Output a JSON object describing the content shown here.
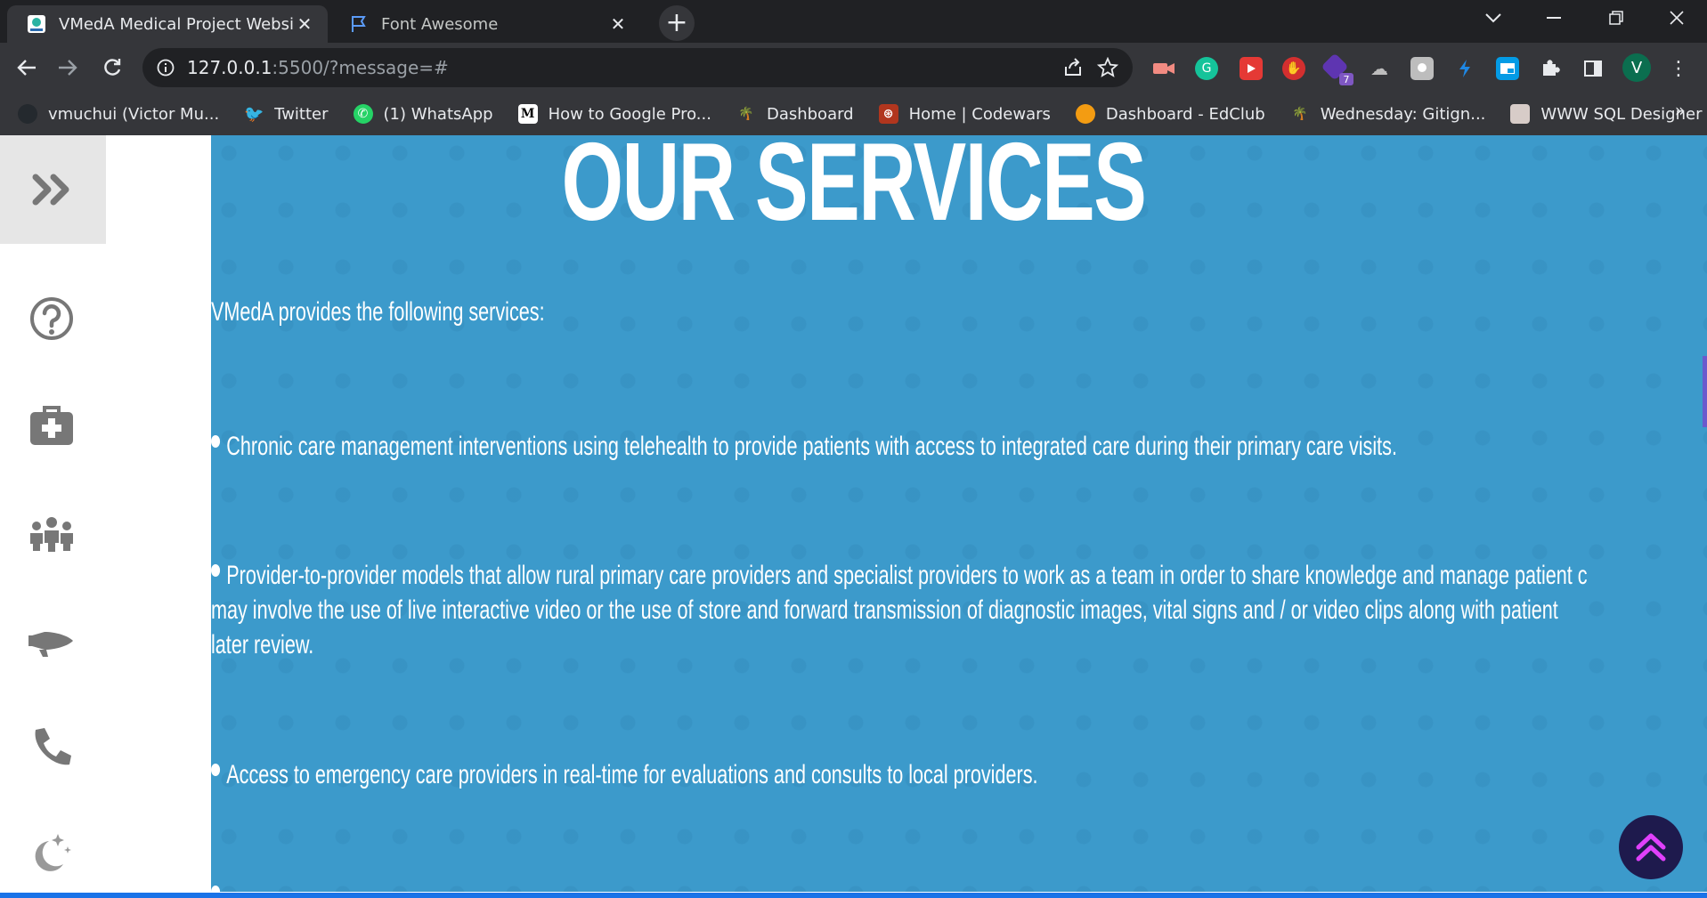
{
  "browser": {
    "tabs": [
      {
        "title": "VMedA Medical Project Website",
        "active": true
      },
      {
        "title": "Font Awesome",
        "active": false
      }
    ],
    "url": {
      "host": "127.0.0.1",
      "path": ":5500/?message=#"
    },
    "profile_initial": "V",
    "extension_badge": "7",
    "bookmarks": [
      {
        "label": "vmuchui (Victor Mu...",
        "icon": "github-icon"
      },
      {
        "label": "Twitter",
        "icon": "twitter-icon"
      },
      {
        "label": "(1) WhatsApp",
        "icon": "whatsapp-icon"
      },
      {
        "label": "How to Google Pro...",
        "icon": "medium-icon",
        "icon_text": "M"
      },
      {
        "label": "Dashboard",
        "icon": "palm-icon"
      },
      {
        "label": "Home | Codewars",
        "icon": "codewars-icon"
      },
      {
        "label": "Dashboard - EdClub",
        "icon": "edclub-icon"
      },
      {
        "label": "Wednesday: Gitign...",
        "icon": "palm-icon"
      },
      {
        "label": "WWW SQL Designer",
        "icon": "sql-designer-icon"
      }
    ],
    "bookmarks_more": "»"
  },
  "page": {
    "heading": "OUR SERVICES",
    "intro": "VMedA provides the following services:",
    "services": [
      "Chronic care management interventions using telehealth to provide patients with access to integrated care during their primary care visits.",
      "Provider-to-provider models that allow rural primary care providers and specialist providers to work as a team in order to share knowledge and manage patient c",
      "may involve the use of live interactive video or the use of store and forward transmission of diagnostic images, vital signs and / or video clips along with patient",
      "later review.",
      "Access to emergency care providers in real-time for evaluations and consults to local providers."
    ],
    "sidebar_icons": [
      "question-circle-icon",
      "medkit-icon",
      "users-icon",
      "megaphone-icon",
      "phone-icon",
      "moon-stars-icon"
    ]
  },
  "colors": {
    "content_bg": "#3c9acb",
    "browser_dark": "#202124",
    "browser_toolbar": "#35363a",
    "scroll_top_button": "#1e1a4d",
    "accent_pink": "#e040fb"
  }
}
